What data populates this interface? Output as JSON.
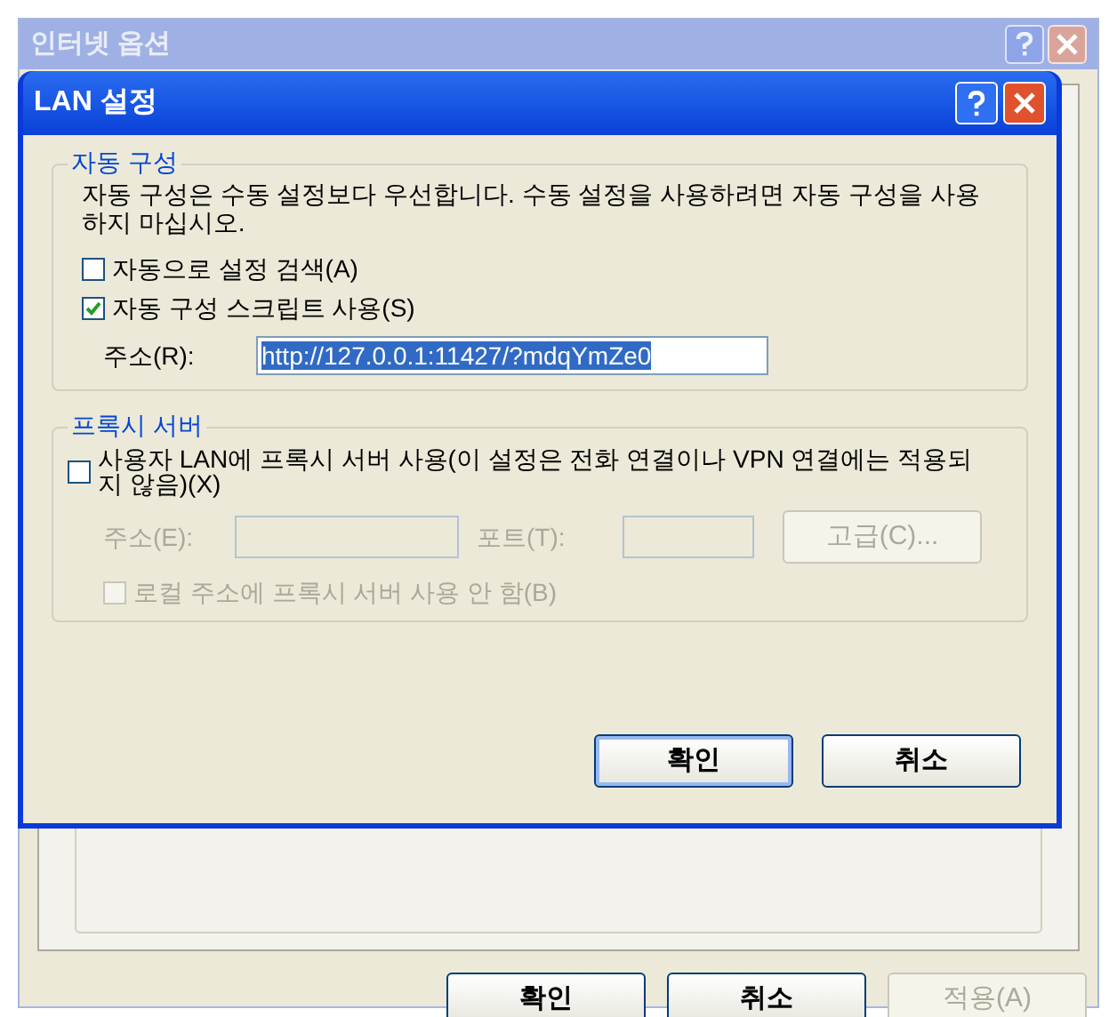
{
  "background_window": {
    "title": "인터넷 옵션",
    "buttons": [
      {
        "label": "확인",
        "disabled": false
      },
      {
        "label": "취소",
        "disabled": false
      },
      {
        "label": "적용(A)",
        "disabled": true
      }
    ]
  },
  "dialog": {
    "title": "LAN 설정",
    "auto_config": {
      "title": "자동 구성",
      "description": "자동 구성은 수동 설정보다 우선합니다. 수동 설정을 사용하려면 자동 구성을 사용하지 마십시오.",
      "options": [
        {
          "label": "자동으로 설정 검색(A)",
          "checked": false
        },
        {
          "label": "자동 구성 스크립트 사용(S)",
          "checked": true
        }
      ],
      "address": {
        "label": "주소(R):",
        "value": "http://127.0.0.1:11427/?mdqYmZe0",
        "selected": true
      }
    },
    "proxy": {
      "title": "프록시 서버",
      "use_proxy": {
        "label": "사용자 LAN에 프록시 서버 사용(이 설정은 전화 연결이나 VPN 연결에는 적용되지 않음)(X)",
        "checked": false
      },
      "address": {
        "label": "주소(E):",
        "disabled": true
      },
      "port": {
        "label": "포트(T):",
        "disabled": true
      },
      "advanced_button": {
        "label": "고급(C)...",
        "disabled": true
      },
      "bypass_local": {
        "label": "로컬 주소에 프록시 서버 사용 안 함(B)",
        "checked": false,
        "disabled": true
      }
    },
    "buttons": [
      {
        "label": "확인",
        "default": true
      },
      {
        "label": "취소",
        "default": false
      }
    ]
  }
}
